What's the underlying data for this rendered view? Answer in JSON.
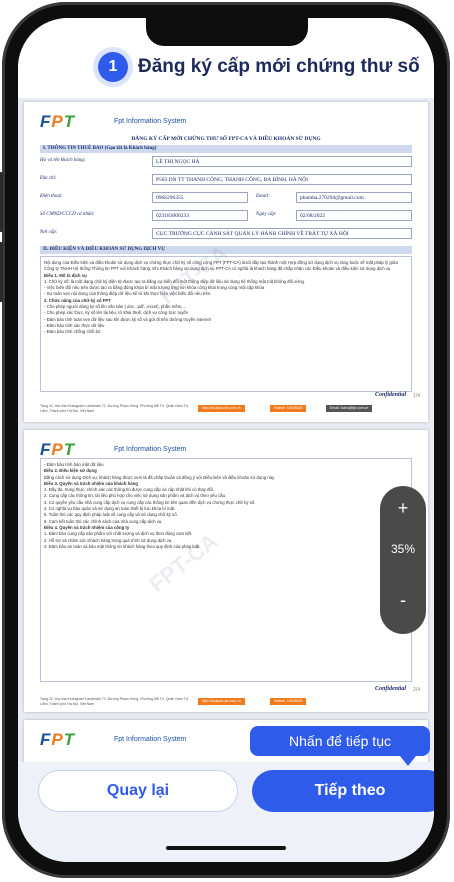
{
  "header": {
    "step_number": "1",
    "title": "Đăng ký cấp mới chứng thư số"
  },
  "document": {
    "brand": "FPT",
    "system_name": "Fpt Information System",
    "title": "ĐĂNG KÝ CẤP MỚI CHỨNG THƯ SỐ FPT-CA VÀ ĐIỀU KHOẢN SỬ DỤNG",
    "section1": "I.   THÔNG TIN THUÊ BAO (Gạo tất là Khách hàng)",
    "fields": {
      "name_label": "Họ và tên khách hàng:",
      "name_value": "LÊ THỊ NGỌC HÀ",
      "address_label": "Địa chỉ:",
      "address_value": "P503 DN TT THANH CÔNG, THANH CÔNG, BA ĐÌNH, HÀ NỘI",
      "phone_label": "Điện thoại:",
      "phone_value": "0968296355",
      "email_label": "Email:",
      "email_value": "phamha.270294@gmail.com",
      "id_label": "Số CMND/CCCD cá nhân:",
      "id_value": "023183000233",
      "date_label": "Ngày cấp:",
      "date_value": "02/08/2022",
      "place_label": "Nơi cấp:",
      "place_value": "CỤC TRƯỞNG CỤC CẢNH SÁT QUẢN LÝ HÀNH CHÍNH VỀ TRẬT TỰ XÃ HỘI"
    },
    "section2": "II.  ĐIỀU KIỆN VÀ ĐIỀU KHOẢN SỬ DỤNG DỊCH VỤ",
    "terms_page1": [
      "Nội dung của Điều kiện và điều khoản sử dụng dịch vụ chứng thực chữ ký số công cộng FPT (FPT-CA) dưới đây tạo thành một Hợp đồng sử dụng dịch vụ ràng buộc về mặt pháp lý giữa Công ty TNHH Hệ thống Thông tin FPT với Khách hàng. Khi Khách hàng sử dụng dịch vụ FPT-CA có nghĩa là khách hàng đã chấp nhận các Điều khoản và điều kiện sử dụng dịch vụ.",
      "Điều 1. Mô tả dịch vụ",
      "1. Chữ ký số: là một dạng chữ ký điện tử được tạo ra bằng sự biến đổi một thông điệp dữ liệu sử dụng hệ thống mật mã không đối xứng.",
      "- Việc biến đổi nêu trên được tạo ra bằng đúng khóa bí mật tương ứng với khóa công khai trong cùng một cặp khóa",
      "- Sự toàn vẹn nội dung của thông điệp dữ liệu kể từ khi thực hiện việc biến đổi nêu trên.",
      "2. Chức năng của chữ ký số FPT",
      "- Cho phép người dùng ký số lên văn bản (.doc, .pdf, .excel), phần mềm,...",
      "- Cho phép xác thực, ký số lên tài liệu, tờ khai thuế, dịch vụ công trực tuyến",
      "- Đảm bảo tính toàn vẹn dữ liệu sau khi được ký số và gửi đi trên đường truyền internet",
      "- Đảm bảo tính xác thực dữ liệu",
      "- Đảm bảo tính chống chối bỏ"
    ],
    "footer_text": "Tầng 22, tòa nhà Keangnam Landmark 72, Đường Phạm Hùng, Phường Mễ Trì, Quận Nam Từ Liêm, Thành phố Hà Nội, Việt Nam",
    "footer_web": "http://chukyso.fpt.com.vn",
    "footer_hotline": "Hotline: 19006625",
    "footer_email": "Email: hotro@fpt.com.vn",
    "confidential": "Confidential",
    "page1_num": "1/4",
    "page2_num": "2/4",
    "terms_page2": [
      "- Đảm bảo tính bảo mật dữ liệu",
      "Điều 2. Điều kiện sử dụng",
      "Bằng cách sử dụng Dịch vụ, khách hàng được xem là đã chấp thuận và đồng ý với Điều kiện và điều khoản sử dụng này.",
      "Điều 3. Quyền và trách nhiệm của khách hàng",
      "1. Đầy đủ, trung thực, chính xác các thông tin được cung cấp và cập nhật khi có thay đổi.",
      "2. Cung cấp các thông tin, tài liệu phù hợp cho việc sử dụng sản phẩm và dịch vụ theo yêu cầu.",
      "3. Có quyền yêu cầu nhà cung cấp dịch vụ cung cấp các thông tin liên quan đến dịch vụ chứng thực chữ ký số.",
      "4. Có nghĩa vụ bảo quản và sử dụng an toàn thiết bị lưu khóa bí mật.",
      "5. Tuân thủ các quy định pháp luật về cung cấp và sử dụng chữ ký số.",
      "6. Cam kết tuân thủ các chính sách của nhà cung cấp dịch vụ.",
      "Điều 4. Quyền và trách nhiệm của công ty",
      "1. Đảm bảo cung cấp sản phẩm với chất lượng và dịch vụ theo đúng cam kết.",
      "2. Hỗ trợ và chăm sóc Khách hàng trong quá trình sử dụng dịch vụ.",
      "3. Đảm bảo an toàn và bảo mật thông tin khách hàng theo quy định của pháp luật."
    ]
  },
  "zoom": {
    "plus": "+",
    "value": "35%",
    "minus": "-"
  },
  "tooltip": "Nhấn để tiếp tục",
  "buttons": {
    "back": "Quay lại",
    "next": "Tiếp theo"
  },
  "colors": {
    "accent": "#2f5bea",
    "frame": "#0e0e0e"
  }
}
